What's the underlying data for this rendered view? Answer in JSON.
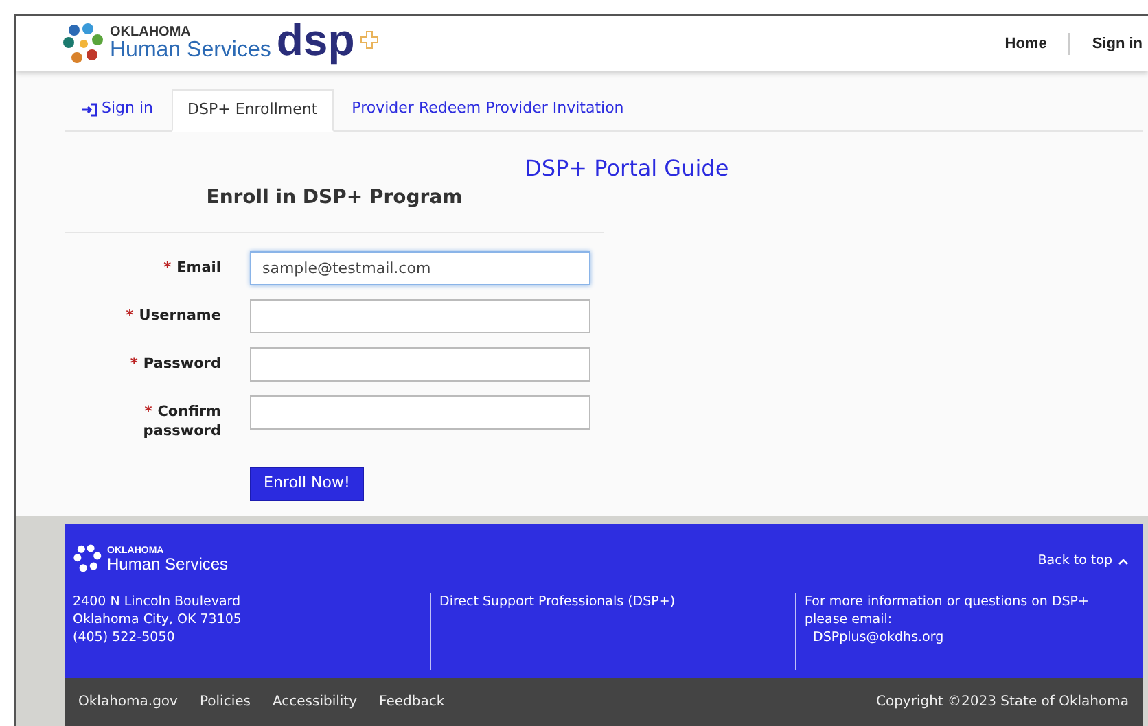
{
  "header": {
    "logo_small": "OKLAHOMA",
    "logo_large": "Human Services",
    "logo_brand": "dsp",
    "nav": [
      "Home",
      "Sign in"
    ]
  },
  "tabs": [
    {
      "label": "Sign in",
      "selected": false,
      "icon": true
    },
    {
      "label": "DSP+ Enrollment",
      "selected": true,
      "icon": false
    },
    {
      "label": "Provider Redeem Provider Invitation",
      "selected": false,
      "icon": false
    }
  ],
  "guide_link": "DSP+ Portal Guide",
  "form": {
    "title": "Enroll in DSP+ Program",
    "fields": [
      {
        "label": "Email",
        "required": true,
        "value": "sample@testmail.com",
        "focused": true
      },
      {
        "label": "Username",
        "required": true,
        "focused": false
      },
      {
        "label": "Password",
        "required": true,
        "focused": false
      },
      {
        "label": "Confirm password",
        "required": true,
        "focused": false
      }
    ],
    "required_mark": "*",
    "submit": "Enroll Now!"
  },
  "footer": {
    "logo_small": "OKLAHOMA",
    "logo_large": "Human Services",
    "back_to_top": "Back to top",
    "address": [
      "2400 N Lincoln Boulevard",
      "Oklahoma City, OK 73105",
      "(405) 522-5050"
    ],
    "program": "Direct Support Professionals (DSP+)",
    "contact": "For more information or questions on DSP+ please email:",
    "email": "DSPplus@okdhs.org",
    "links": [
      "Oklahoma.gov",
      "Policies",
      "Accessibility",
      "Feedback"
    ],
    "copyright": "Copyright ©2023 State of Oklahoma"
  }
}
